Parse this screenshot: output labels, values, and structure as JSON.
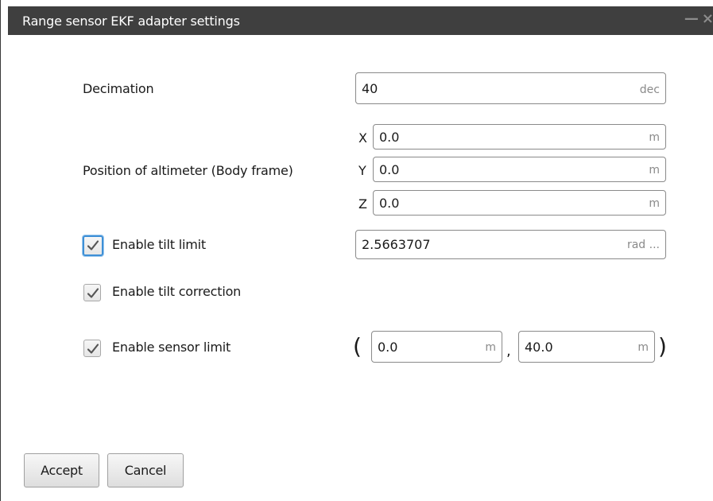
{
  "window": {
    "title": "Range sensor EKF adapter settings",
    "minimize_glyph": "—",
    "close_glyph": "×"
  },
  "decimation": {
    "label": "Decimation",
    "value": "40",
    "unit": "dec"
  },
  "position": {
    "label": "Position of altimeter (Body frame)",
    "x": {
      "axis": "X",
      "value": "0.0",
      "unit": "m"
    },
    "y": {
      "axis": "Y",
      "value": "0.0",
      "unit": "m"
    },
    "z": {
      "axis": "Z",
      "value": "0.0",
      "unit": "m"
    }
  },
  "tilt_limit": {
    "label": "Enable tilt limit",
    "checked": true,
    "value": "2.5663707",
    "unit": "rad ..."
  },
  "tilt_correction": {
    "label": "Enable tilt correction",
    "checked": true
  },
  "sensor_limit": {
    "label": "Enable sensor limit",
    "checked": true,
    "open_paren": "(",
    "close_paren": ")",
    "separator": ",",
    "min": {
      "value": "0.0",
      "unit": "m"
    },
    "max": {
      "value": "40.0",
      "unit": "m"
    }
  },
  "buttons": {
    "accept": "Accept",
    "cancel": "Cancel"
  },
  "colors": {
    "titlebar": "#3f3f3f",
    "focus_accent": "#3d8fd6"
  }
}
